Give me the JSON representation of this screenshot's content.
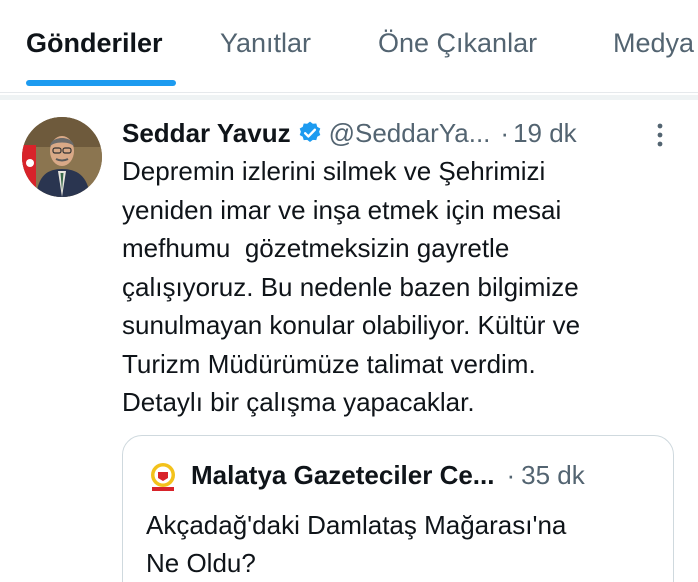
{
  "tabs": [
    {
      "label": "Gönderiler",
      "active": true
    },
    {
      "label": "Yanıtlar",
      "active": false
    },
    {
      "label": "Öne Çıkanlar",
      "active": false
    },
    {
      "label": "Medya",
      "active": false
    }
  ],
  "post": {
    "author_name": "Seddar Yavuz",
    "handle": "@SeddarYa...",
    "separator": "·",
    "time": "19 dk",
    "body_lines": [
      "Depremin izlerini silmek ve Şehrimizi",
      "yeniden imar ve inşa etmek için mesai",
      "mefhumu  gözetmeksizin gayretle",
      "çalışıyoruz. Bu nedenle bazen bilgimize",
      "sunulmayan konular olabiliyor. Kültür ve",
      "Turizm Müdürümüze talimat verdim.",
      "Detaylı bir çalışma yapacaklar."
    ]
  },
  "quote": {
    "author_name": "Malatya Gazeteciler Ce...",
    "separator": "·",
    "time": "35 dk",
    "text_lines": [
      "Akçadağ'daki Damlataş Mağarası'na",
      "Ne Oldu?"
    ]
  },
  "colors": {
    "accent": "#1d9bf0",
    "text_primary": "#0f1419",
    "text_secondary": "#536471",
    "verified": "#1d9bf0"
  },
  "icons": {
    "verified": "verified-badge-icon",
    "more": "more-options-icon"
  }
}
